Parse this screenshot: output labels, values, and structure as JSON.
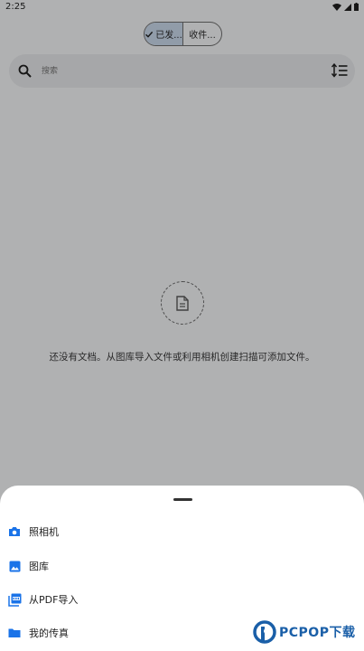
{
  "status_bar": {
    "time": "2:25"
  },
  "filter": {
    "selected_label": "已发...",
    "other_label": "收件..."
  },
  "search": {
    "placeholder": "搜索"
  },
  "empty_state": {
    "message": "还没有文档。从图库导入文件或利用相机创建扫描可添加文件。"
  },
  "sheet": {
    "items": [
      {
        "label": "照相机",
        "icon": "camera-icon"
      },
      {
        "label": "图库",
        "icon": "image-icon"
      },
      {
        "label": "从PDF导入",
        "icon": "pdf-icon"
      },
      {
        "label": "我的传真",
        "icon": "folder-icon"
      }
    ]
  },
  "watermark": {
    "text": "PCPOP下载"
  },
  "colors": {
    "accent": "#1a73e8",
    "scrim": "#000000"
  }
}
